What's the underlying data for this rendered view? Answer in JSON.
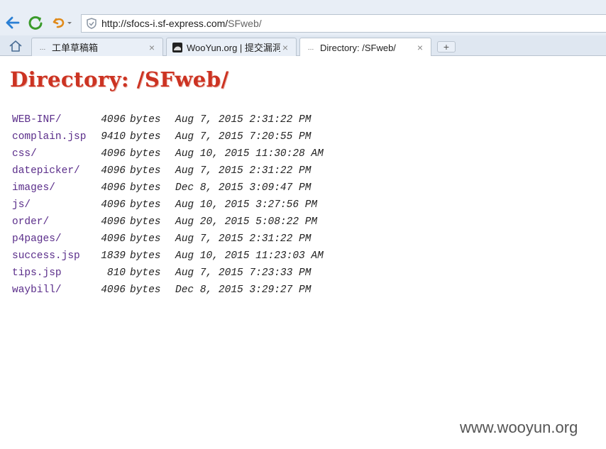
{
  "browser": {
    "url_host": "http://sfocs-i.sf-express.com/",
    "url_path": "SFweb/",
    "tabs": [
      {
        "title": "工单草稿箱",
        "favicon": "…"
      },
      {
        "title": "WooYun.org | 提交漏洞",
        "favicon": "wooyun-logo"
      },
      {
        "title": "Directory: /SFweb/",
        "favicon": "…"
      }
    ],
    "active_tab": 2,
    "new_tab_label": "+"
  },
  "page": {
    "heading": "Directory: /SFweb/",
    "entries": [
      {
        "name": "WEB-INF/",
        "size": "4096",
        "unit": "bytes",
        "date": "Aug 7, 2015 2:31:22 PM"
      },
      {
        "name": "complain.jsp",
        "size": "9410",
        "unit": "bytes",
        "date": "Aug 7, 2015 7:20:55 PM"
      },
      {
        "name": "css/",
        "size": "4096",
        "unit": "bytes",
        "date": "Aug 10, 2015 11:30:28 AM"
      },
      {
        "name": "datepicker/",
        "size": "4096",
        "unit": "bytes",
        "date": "Aug 7, 2015 2:31:22 PM"
      },
      {
        "name": "images/",
        "size": "4096",
        "unit": "bytes",
        "date": "Dec 8, 2015 3:09:47 PM"
      },
      {
        "name": "js/",
        "size": "4096",
        "unit": "bytes",
        "date": "Aug 10, 2015 3:27:56 PM"
      },
      {
        "name": "order/",
        "size": "4096",
        "unit": "bytes",
        "date": "Aug 20, 2015 5:08:22 PM"
      },
      {
        "name": "p4pages/",
        "size": "4096",
        "unit": "bytes",
        "date": "Aug 7, 2015 2:31:22 PM"
      },
      {
        "name": "success.jsp",
        "size": "1839",
        "unit": "bytes",
        "date": "Aug 10, 2015 11:23:03 AM"
      },
      {
        "name": "tips.jsp",
        "size": "810",
        "unit": "bytes",
        "date": "Aug 7, 2015 7:23:33 PM"
      },
      {
        "name": "waybill/",
        "size": "4096",
        "unit": "bytes",
        "date": "Dec 8, 2015 3:29:27 PM"
      }
    ]
  },
  "watermark": "www.wooyun.org",
  "colors": {
    "heading": "#cc3322",
    "link": "#5a2d8a",
    "back_arrow": "#2a7fd4",
    "refresh": "#3a9a2a",
    "undo": "#e08a1a"
  }
}
